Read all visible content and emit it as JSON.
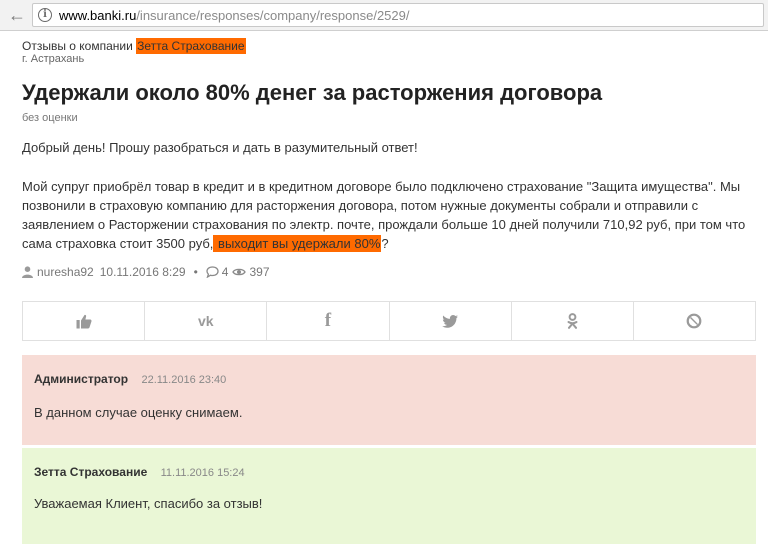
{
  "browser": {
    "url_host": "www.banki.ru",
    "url_path": "/insurance/responses/company/response/2529/"
  },
  "review": {
    "company_prefix": "Отзывы о компании",
    "company_name": "Зетта Страхование",
    "city": "г. Астрахань",
    "title": "Удержали около 80% денег за расторжения договора",
    "rating": "без оценки",
    "paragraph1": "Добрый день! Прошу разобраться и дать в разумительный ответ!",
    "paragraph2_main": "Мой супруг приобрёл товар в кредит и в кредитном договоре было подключено страхование \"Защита имущества\". Мы позвонили в страховую компанию для расторжения договора, потом нужные документы собрали и отправили с заявлением о Расторжении страхования по электр. почте, прождали больше 10 дней получили 710,92 руб, при том что сама страховка стоит 3500 руб,",
    "paragraph2_highlight": " выходит вы удержали 80%",
    "paragraph2_end": "?",
    "author": "nuresha92",
    "datetime": "10.11.2016 8:29",
    "separator": "•",
    "comments_count": "4",
    "views_count": "397"
  },
  "share": {
    "icons": [
      "like-icon",
      "vk-icon",
      "facebook-icon",
      "twitter-icon",
      "odnoklassniki-icon",
      "livejournal-icon"
    ],
    "labels": {
      "vk": "vk",
      "facebook": "f"
    }
  },
  "comments": [
    {
      "author": "Администратор",
      "date": "22.11.2016 23:40",
      "text": "В данном случае оценку снимаем.",
      "color": "#f7dcd6"
    },
    {
      "author": "Зетта Страхование",
      "date": "11.11.2016 15:24",
      "text": "Уважаемая Клиент, спасибо за отзыв!",
      "color": "#eaf7d6"
    }
  ],
  "colors": {
    "highlight": "#ff6a00"
  }
}
